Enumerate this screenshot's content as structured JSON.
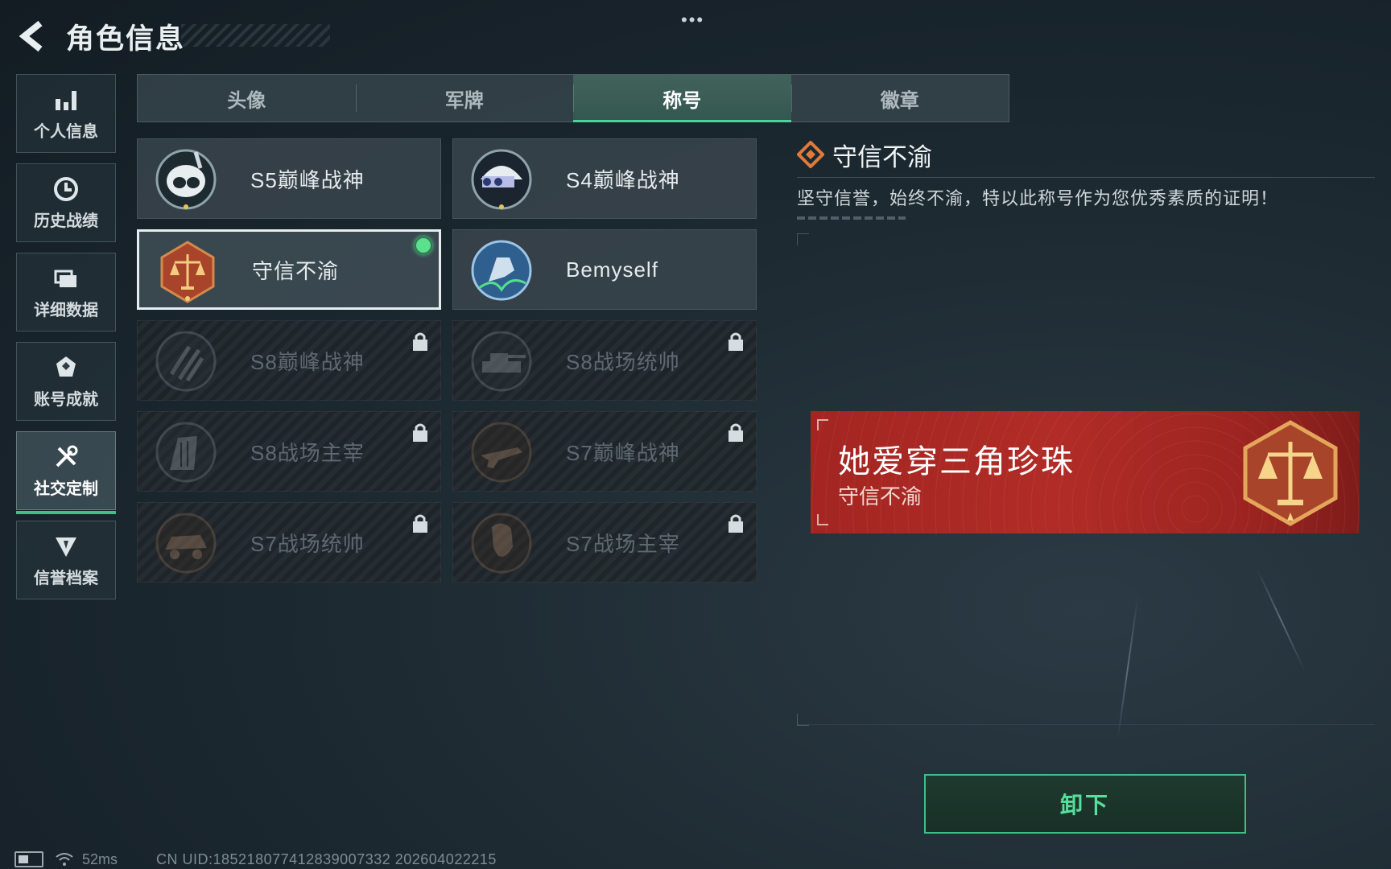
{
  "header": {
    "title": "角色信息",
    "menu_dots": "•••"
  },
  "sidebar": {
    "items": [
      {
        "label": "个人信息",
        "icon": "bar-chart-icon",
        "active": false
      },
      {
        "label": "历史战绩",
        "icon": "history-clock-icon",
        "active": false
      },
      {
        "label": "详细数据",
        "icon": "folder-icon",
        "active": false
      },
      {
        "label": "账号成就",
        "icon": "medal-icon",
        "active": false
      },
      {
        "label": "社交定制",
        "icon": "tools-icon",
        "active": true
      },
      {
        "label": "信誉档案",
        "icon": "shield-icon",
        "active": false
      }
    ]
  },
  "tabs": [
    {
      "label": "头像",
      "active": false
    },
    {
      "label": "军牌",
      "active": false
    },
    {
      "label": "称号",
      "active": true
    },
    {
      "label": "徽章",
      "active": false
    }
  ],
  "titles": [
    {
      "name": "S5巅峰战神",
      "locked": false,
      "selected": false,
      "equipped": false
    },
    {
      "name": "S4巅峰战神",
      "locked": false,
      "selected": false,
      "equipped": false
    },
    {
      "name": "守信不渝",
      "locked": false,
      "selected": true,
      "equipped": true
    },
    {
      "name": "Bemyself",
      "locked": false,
      "selected": false,
      "equipped": false
    },
    {
      "name": "S8巅峰战神",
      "locked": true,
      "selected": false,
      "equipped": false
    },
    {
      "name": "S8战场统帅",
      "locked": true,
      "selected": false,
      "equipped": false
    },
    {
      "name": "S8战场主宰",
      "locked": true,
      "selected": false,
      "equipped": false
    },
    {
      "name": "S7巅峰战神",
      "locked": true,
      "selected": false,
      "equipped": false
    },
    {
      "name": "S7战场统帅",
      "locked": true,
      "selected": false,
      "equipped": false
    },
    {
      "name": "S7战场主宰",
      "locked": true,
      "selected": false,
      "equipped": false
    }
  ],
  "detail": {
    "title": "守信不渝",
    "description": "坚守信誉，始终不渝，特以此称号作为您优秀素质的证明！"
  },
  "banner": {
    "player_name": "她爱穿三角珍珠",
    "title_text": "守信不渝"
  },
  "actions": {
    "unequip_label": "卸下"
  },
  "status": {
    "ping": "52ms",
    "uid": "CN UID:185218077412839007332 202604022215"
  },
  "colors": {
    "accent_green": "#3fbf8a",
    "banner_red": "#a32521",
    "equipped_dot": "#5be08e"
  }
}
